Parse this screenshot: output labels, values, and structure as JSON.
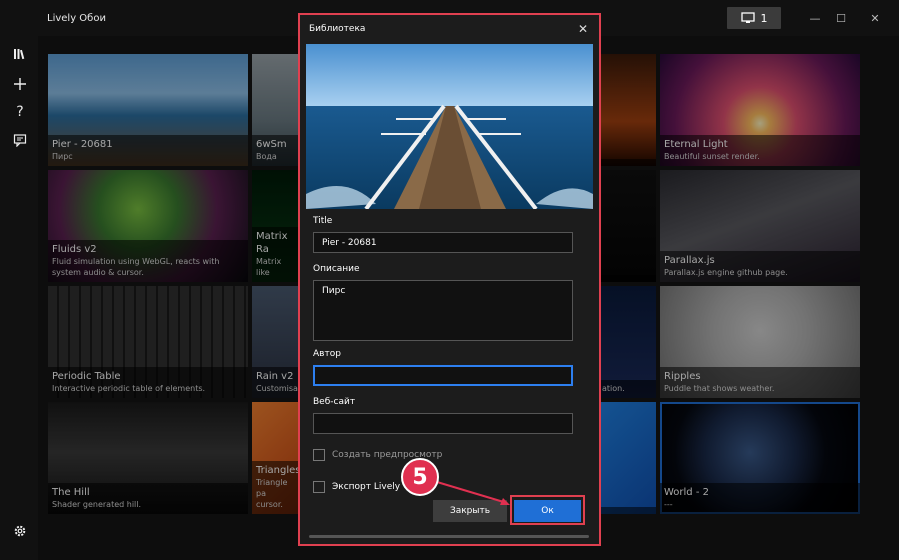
{
  "app": {
    "title": "Lively Обои",
    "monitor_count": "1"
  },
  "window_controls": {
    "minimize": "—",
    "maximize": "☐",
    "close": "✕"
  },
  "tiles": [
    {
      "title": "Pier - 20681",
      "desc": "Пирс"
    },
    {
      "title": "6wSm",
      "desc": "Вода"
    },
    {
      "title": "",
      "desc": ""
    },
    {
      "title": "Eternal Light",
      "desc": "Beautiful sunset render."
    },
    {
      "title": "Fluids v2",
      "desc": "Fluid simulation using WebGL, reacts with system audio & cursor."
    },
    {
      "title": "Matrix Ra",
      "desc": "Matrix like"
    },
    {
      "title": "",
      "desc": ""
    },
    {
      "title": "Parallax.js",
      "desc": "Parallax.js engine github page."
    },
    {
      "title": "Periodic Table",
      "desc": "Interactive periodic table of elements."
    },
    {
      "title": "Rain v2",
      "desc": "Customisa"
    },
    {
      "title": "",
      "desc": "ation."
    },
    {
      "title": "Ripples",
      "desc": "Puddle that shows weather."
    },
    {
      "title": "The Hill",
      "desc": "Shader generated hill."
    },
    {
      "title": "Triangles",
      "desc": "Triangle pa cursor."
    },
    {
      "title": "",
      "desc": ""
    },
    {
      "title": "World - 2",
      "desc": "---"
    }
  ],
  "dialog": {
    "title": "Библиотека",
    "title_label": "Title",
    "title_value": "Pier - 20681",
    "description_label": "Описание",
    "description_value": "Пирс",
    "author_label": "Автор",
    "author_value": "",
    "website_label": "Веб-сайт",
    "website_value": "",
    "create_preview_label": "Создать предпросмотр",
    "export_label": "Экспорт Lively",
    "close_button": "Закрыть",
    "ok_button": "Ок"
  },
  "annotation": {
    "step": "5"
  },
  "colors": {
    "accent": "#1f6fd6",
    "highlight": "#e04050"
  }
}
